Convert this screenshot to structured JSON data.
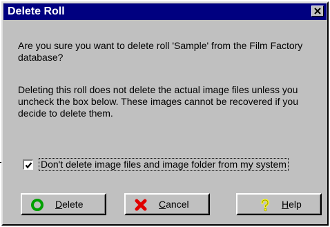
{
  "window": {
    "title": "Delete Roll",
    "close_icon": "close-icon"
  },
  "message": {
    "line1": "Are you sure you want to delete roll 'Sample' from the Film Factory database?",
    "line2": "Deleting this roll does not delete the actual image files unless you uncheck the box below.  These images cannot be recovered if you decide to delete them."
  },
  "checkbox": {
    "label": "Don't delete image files and image folder from my system",
    "checked": true
  },
  "buttons": {
    "delete": "Delete",
    "cancel": "Cancel",
    "help": "Help"
  },
  "icons": {
    "delete": "green-circle-icon",
    "cancel": "red-x-icon",
    "help": "yellow-question-icon"
  },
  "colors": {
    "titlebar": "#000080",
    "face": "#c0c0c0",
    "delete_icon": "#00a000",
    "cancel_icon": "#e00000",
    "help_icon": "#ffff00"
  }
}
